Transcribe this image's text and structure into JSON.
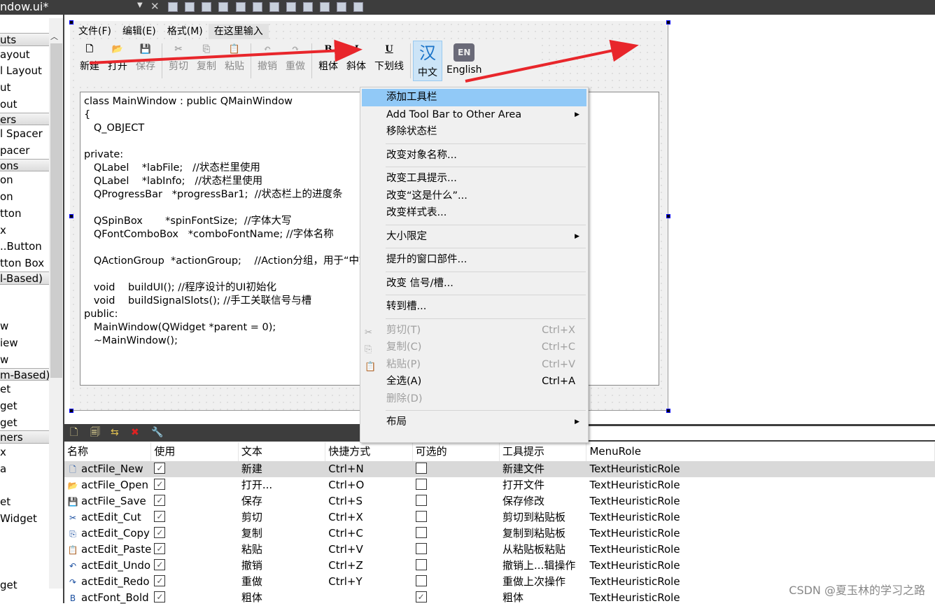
{
  "window": {
    "title": "ndow.ui*"
  },
  "sidebar": {
    "items": [
      {
        "t": "h",
        "label": "uts"
      },
      {
        "t": "i",
        "label": "ayout"
      },
      {
        "t": "i",
        "label": "l Layout"
      },
      {
        "t": "i",
        "label": "ut"
      },
      {
        "t": "i",
        "label": "out"
      },
      {
        "t": "h",
        "label": "ers"
      },
      {
        "t": "i",
        "label": "l Spacer"
      },
      {
        "t": "i",
        "label": "pacer"
      },
      {
        "t": "h",
        "label": "ons"
      },
      {
        "t": "i",
        "label": "on"
      },
      {
        "t": "i",
        "label": "on"
      },
      {
        "t": "i",
        "label": "tton"
      },
      {
        "t": "i",
        "label": "x"
      },
      {
        "t": "i",
        "label": "..Button"
      },
      {
        "t": "i",
        "label": "tton Box"
      },
      {
        "t": "h",
        "label": "l-Based)"
      },
      {
        "t": "i",
        "label": ""
      },
      {
        "t": "i",
        "label": ""
      },
      {
        "t": "i",
        "label": "w"
      },
      {
        "t": "i",
        "label": "iew"
      },
      {
        "t": "i",
        "label": "w"
      },
      {
        "t": "h",
        "label": "m-Based)"
      },
      {
        "t": "i",
        "label": "et"
      },
      {
        "t": "i",
        "label": "get"
      },
      {
        "t": "i",
        "label": "get"
      },
      {
        "t": "h",
        "label": "ners"
      },
      {
        "t": "i",
        "label": "x"
      },
      {
        "t": "i",
        "label": "a"
      },
      {
        "t": "i",
        "label": ""
      },
      {
        "t": "i",
        "label": "et"
      },
      {
        "t": "i",
        "label": "Widget"
      },
      {
        "t": "i",
        "label": ""
      },
      {
        "t": "i",
        "label": ""
      },
      {
        "t": "i",
        "label": ""
      },
      {
        "t": "i",
        "label": "get"
      }
    ]
  },
  "menubar": [
    "文件(F)",
    "编辑(E)",
    "格式(M)",
    "在这里输入"
  ],
  "toolbar": [
    {
      "label": "新建",
      "icon": "new-file-icon",
      "glyph": "🗋",
      "dis": false
    },
    {
      "label": "打开",
      "icon": "folder-open-icon",
      "glyph": "📂",
      "dis": false
    },
    {
      "label": "保存",
      "icon": "save-icon",
      "glyph": "💾",
      "dis": true
    },
    {
      "sep": true
    },
    {
      "label": "剪切",
      "icon": "cut-icon",
      "glyph": "✂",
      "dis": true
    },
    {
      "label": "复制",
      "icon": "copy-icon",
      "glyph": "⎘",
      "dis": true
    },
    {
      "label": "粘贴",
      "icon": "paste-icon",
      "glyph": "📋",
      "dis": true
    },
    {
      "sep": true
    },
    {
      "label": "撤销",
      "icon": "undo-icon",
      "glyph": "↶",
      "dis": true
    },
    {
      "label": "重做",
      "icon": "redo-icon",
      "glyph": "↷",
      "dis": true
    },
    {
      "sep": true
    },
    {
      "label": "粗体",
      "icon": "bold-icon",
      "glyph": "B",
      "dis": false
    },
    {
      "label": "斜体",
      "icon": "italic-icon",
      "glyph": "I",
      "dis": false
    },
    {
      "label": "下划线",
      "icon": "underline-icon",
      "glyph": "U",
      "dis": false
    },
    {
      "sep": true
    },
    {
      "label": "中文",
      "icon": "chinese-icon",
      "glyph": "汉",
      "dis": false,
      "sel": true
    },
    {
      "label": "English",
      "icon": "english-icon",
      "glyph": "EN",
      "dis": false
    }
  ],
  "editor": {
    "text": "class MainWindow : public QMainWindow\n{\n   Q_OBJECT\n\nprivate:\n   QLabel    *labFile;   //状态栏里使用\n   QLabel    *labInfo;   //状态栏里使用\n   QProgressBar   *progressBar1;  //状态栏上的进度条\n\n   QSpinBox       *spinFontSize;  //字体大写\n   QFontComboBox   *comboFontName; //字体名称\n\n   QActionGroup  *actionGroup;    //Action分组，用于“中文”\n\n   void    buildUI(); //程序设计的UI初始化\n   void    buildSignalSlots(); //手工关联信号与槽\npublic:\n   MainWindow(QWidget *parent = 0);\n   ~MainWindow();"
  },
  "context_menu": [
    {
      "label": "添加工具栏",
      "hl": true
    },
    {
      "label": "Add Tool Bar to Other Area",
      "sub": true
    },
    {
      "label": "移除状态栏"
    },
    {
      "sep": true
    },
    {
      "label": "改变对象名称..."
    },
    {
      "sep": true
    },
    {
      "label": "改变工具提示..."
    },
    {
      "label": "改变“这是什么”..."
    },
    {
      "label": "改变样式表..."
    },
    {
      "sep": true
    },
    {
      "label": "大小限定",
      "sub": true
    },
    {
      "sep": true
    },
    {
      "label": "提升的窗口部件..."
    },
    {
      "sep": true
    },
    {
      "label": "改变 信号/槽..."
    },
    {
      "sep": true
    },
    {
      "label": "转到槽..."
    },
    {
      "sep": true
    },
    {
      "label": "剪切(T)",
      "sc": "Ctrl+X",
      "dis": true,
      "icon": "cut-icon",
      "glyph": "✂"
    },
    {
      "label": "复制(C)",
      "sc": "Ctrl+C",
      "dis": true,
      "icon": "copy-icon",
      "glyph": "⎘"
    },
    {
      "label": "粘贴(P)",
      "sc": "Ctrl+V",
      "dis": true,
      "icon": "paste-icon",
      "glyph": "📋"
    },
    {
      "label": "全选(A)",
      "sc": "Ctrl+A"
    },
    {
      "label": "删除(D)",
      "dis": true
    },
    {
      "sep": true
    },
    {
      "label": "布局",
      "sub": true
    }
  ],
  "action_editor": {
    "toolbar_icons": [
      "new-action-icon",
      "copy-action-icon",
      "paste-action-icon",
      "delete-action-icon",
      "configure-icon"
    ],
    "columns": [
      "名称",
      "使用",
      "文本",
      "快捷方式",
      "可选的",
      "工具提示",
      "MenuRole"
    ],
    "rows": [
      {
        "name": "actFile_New",
        "icon": "new-file-icon",
        "glyph": "🗋",
        "used": true,
        "text": "新建",
        "shortcut": "Ctrl+N",
        "checkable": false,
        "tooltip": "新建文件",
        "role": "TextHeuristicRole"
      },
      {
        "name": "actFile_Open",
        "icon": "folder-open-icon",
        "glyph": "📂",
        "used": true,
        "text": "打开...",
        "shortcut": "Ctrl+O",
        "checkable": false,
        "tooltip": "打开文件",
        "role": "TextHeuristicRole"
      },
      {
        "name": "actFile_Save",
        "icon": "save-icon",
        "glyph": "💾",
        "used": true,
        "text": "保存",
        "shortcut": "Ctrl+S",
        "checkable": false,
        "tooltip": "保存修改",
        "role": "TextHeuristicRole"
      },
      {
        "name": "actEdit_Cut",
        "icon": "cut-icon",
        "glyph": "✂",
        "used": true,
        "text": "剪切",
        "shortcut": "Ctrl+X",
        "checkable": false,
        "tooltip": "剪切到粘贴板",
        "role": "TextHeuristicRole"
      },
      {
        "name": "actEdit_Copy",
        "icon": "copy-icon",
        "glyph": "⎘",
        "used": true,
        "text": "复制",
        "shortcut": "Ctrl+C",
        "checkable": false,
        "tooltip": "复制到粘贴板",
        "role": "TextHeuristicRole"
      },
      {
        "name": "actEdit_Paste",
        "icon": "paste-icon",
        "glyph": "📋",
        "used": true,
        "text": "粘贴",
        "shortcut": "Ctrl+V",
        "checkable": false,
        "tooltip": "从粘贴板粘贴",
        "role": "TextHeuristicRole"
      },
      {
        "name": "actEdit_Undo",
        "icon": "undo-icon",
        "glyph": "↶",
        "used": true,
        "text": "撤销",
        "shortcut": "Ctrl+Z",
        "checkable": false,
        "tooltip": "撤销上...辑操作",
        "role": "TextHeuristicRole"
      },
      {
        "name": "actEdit_Redo",
        "icon": "redo-icon",
        "glyph": "↷",
        "used": true,
        "text": "重做",
        "shortcut": "Ctrl+Y",
        "checkable": false,
        "tooltip": "重做上次操作",
        "role": "TextHeuristicRole"
      },
      {
        "name": "actFont_Bold",
        "icon": "bold-icon",
        "glyph": "B",
        "used": true,
        "text": "粗体",
        "shortcut": "",
        "checkable": true,
        "tooltip": "粗体",
        "role": "TextHeuristicRole"
      }
    ]
  },
  "watermark": "CSDN @夏玉林的学习之路",
  "colors": {
    "highlight": "#91c9f7",
    "arrow": "#e8262b",
    "dark_bar": "#3d3d3d"
  }
}
